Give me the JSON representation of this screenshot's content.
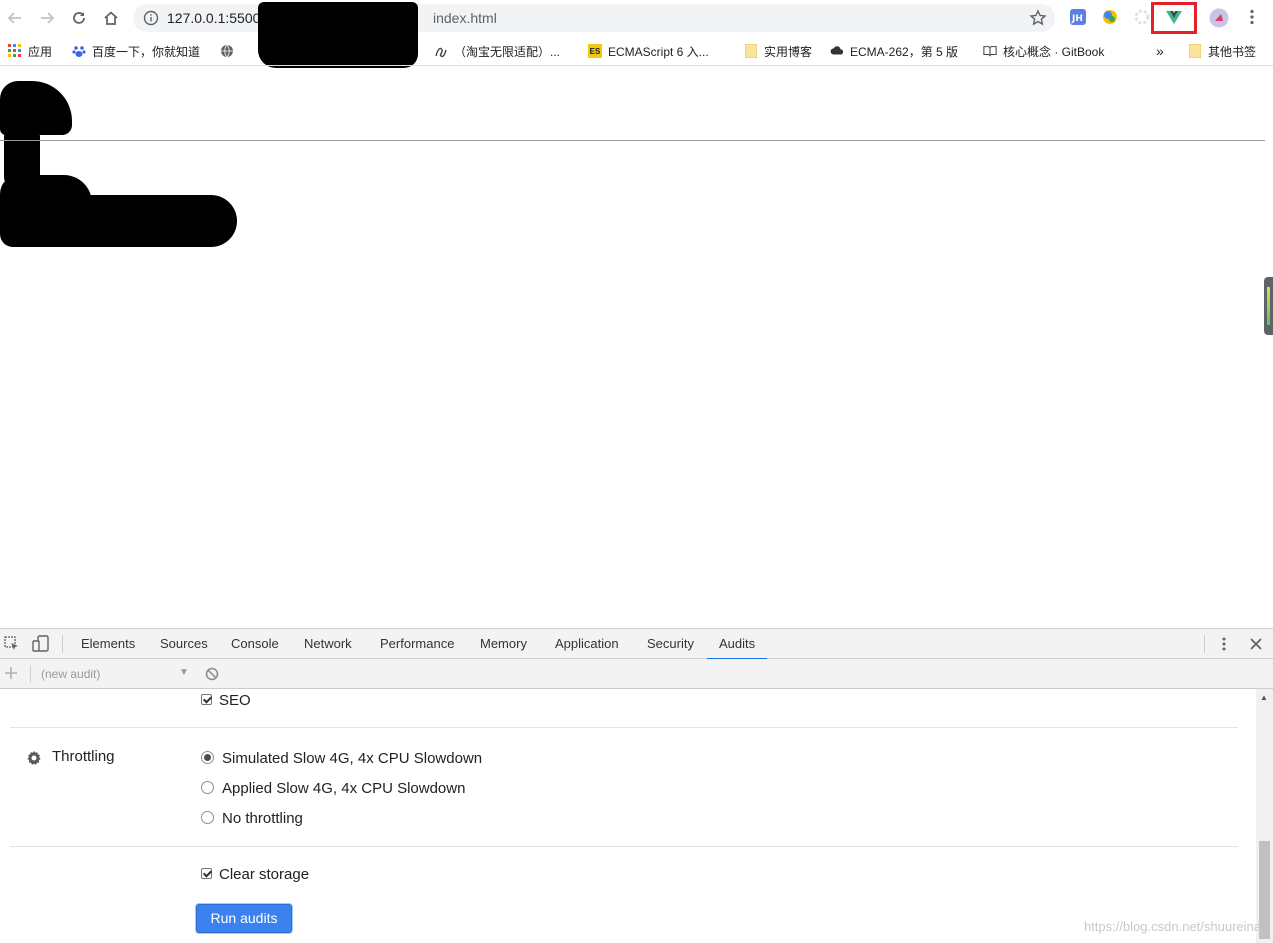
{
  "browser": {
    "url_host": "127.0.0.1:5500",
    "url_path": "index.html",
    "bookmarks": [
      {
        "label": "应用",
        "icon": "apps-grid-icon"
      },
      {
        "label": "百度一下，你就知道",
        "icon": "baidu-paw-icon"
      },
      {
        "label": "（淘宝无限适配）...",
        "icon": "script-icon"
      },
      {
        "label": "ECMAScript 6 入...",
        "icon": "es-badge-icon"
      },
      {
        "label": "实用博客",
        "icon": "folder-icon"
      },
      {
        "label": "ECMA-262，第 5 版",
        "icon": "cloud-icon"
      },
      {
        "label": "核心概念 · GitBook",
        "icon": "book-icon"
      },
      {
        "label": "»",
        "icon": "overflow-chevron-icon"
      },
      {
        "label": "其他书签",
        "icon": "folder-icon"
      }
    ],
    "extensions": [
      "jh-extension-icon",
      "colorful-extension-icon",
      "gear-extension-icon",
      "vue-devtools-icon",
      "avatar-icon"
    ],
    "highlight_color": "#e3212a",
    "vue_color": "#41b883"
  },
  "devtools": {
    "tabs": [
      "Elements",
      "Sources",
      "Console",
      "Network",
      "Performance",
      "Memory",
      "Application",
      "Security",
      "Audits"
    ],
    "active_tab": "Audits",
    "audit_select_placeholder": "(new audit)",
    "seo_label": "SEO",
    "throttling_label": "Throttling",
    "throttling_options": [
      {
        "label": "Simulated Slow 4G, 4x CPU Slowdown",
        "selected": true
      },
      {
        "label": "Applied Slow 4G, 4x CPU Slowdown",
        "selected": false
      },
      {
        "label": "No throttling",
        "selected": false
      }
    ],
    "clear_storage_label": "Clear storage",
    "run_button": "Run audits",
    "accent": "#1a73e8"
  },
  "watermark": "https://blog.csdn.net/shuureina"
}
